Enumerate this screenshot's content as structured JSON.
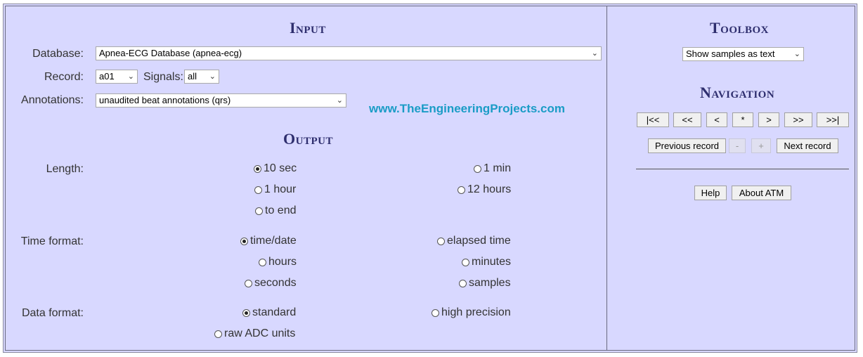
{
  "input": {
    "heading": "Input",
    "database_label": "Database:",
    "database_value": "Apnea-ECG Database (apnea-ecg)",
    "record_label": "Record:",
    "record_value": "a01",
    "signals_label": "Signals:",
    "signals_value": "all",
    "annotations_label": "Annotations:",
    "annotations_value": "unaudited beat annotations (qrs)"
  },
  "watermark": "www.TheEngineeringProjects.com",
  "output": {
    "heading": "Output",
    "length_label": "Length:",
    "length_options": [
      "10 sec",
      "1 min",
      "1 hour",
      "12 hours",
      "to end"
    ],
    "length_selected": "10 sec",
    "time_format_label": "Time format:",
    "time_format_options": [
      "time/date",
      "elapsed time",
      "hours",
      "minutes",
      "seconds",
      "samples"
    ],
    "time_format_selected": "time/date",
    "data_format_label": "Data format:",
    "data_format_options": [
      "standard",
      "high precision",
      "raw ADC units"
    ],
    "data_format_selected": "standard"
  },
  "toolbox": {
    "heading": "Toolbox",
    "select_value": "Show samples as text"
  },
  "navigation": {
    "heading": "Navigation",
    "buttons": [
      "|<<",
      "<<",
      "<",
      "*",
      ">",
      ">>",
      ">>|"
    ],
    "prev_record": "Previous record",
    "minus": "-",
    "plus": "+",
    "next_record": "Next record"
  },
  "footer_buttons": {
    "help": "Help",
    "about": "About ATM"
  }
}
